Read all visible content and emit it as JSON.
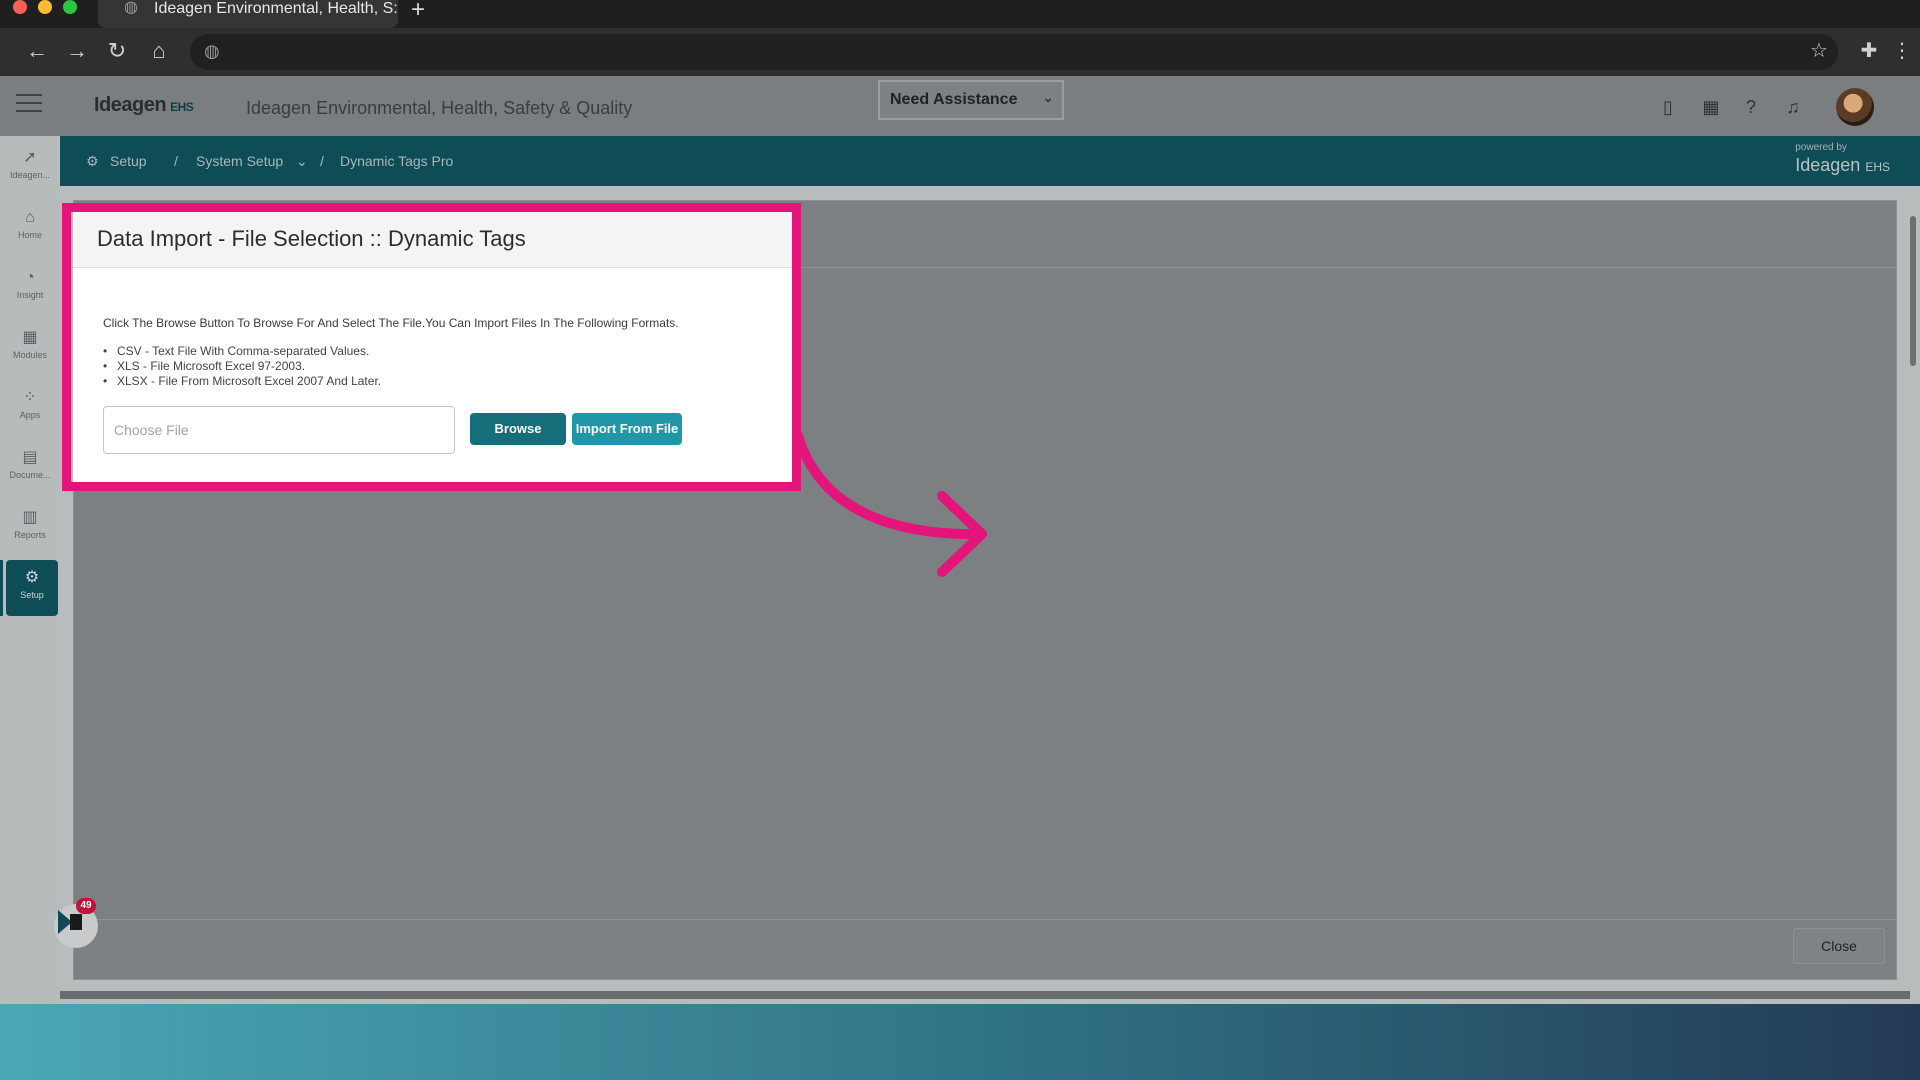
{
  "browser": {
    "tab_title": "Ideagen Environmental, Health, S:",
    "tab_icon": "globe-icon",
    "new_tab_icon": "plus-icon"
  },
  "header": {
    "logo_text": "Ideagen",
    "logo_suffix": "EHS",
    "app_title": "Ideagen Environmental, Health, Safety & Quality",
    "assistance_label": "Need Assistance"
  },
  "breadcrumb": {
    "items": [
      "Setup",
      "System Setup",
      "Dynamic Tags Pro"
    ],
    "separator": "/",
    "powered_by": "powered by",
    "powered_logo": "Ideagen",
    "powered_suffix": "EHS"
  },
  "sidebar": {
    "items": [
      {
        "label": "Ideagen...",
        "icon": "ideagen-icon"
      },
      {
        "label": "Home",
        "icon": "home-icon"
      },
      {
        "label": "Insight",
        "icon": "insight-icon"
      },
      {
        "label": "Modules",
        "icon": "modules-icon"
      },
      {
        "label": "Apps",
        "icon": "apps-icon"
      },
      {
        "label": "Docume...",
        "icon": "document-icon"
      },
      {
        "label": "Reports",
        "icon": "reports-icon"
      },
      {
        "label": "Setup",
        "icon": "gear-icon"
      }
    ]
  },
  "modal": {
    "title": "Data Import - File Selection :: Dynamic Tags",
    "instruction": "Click The Browse Button To Browse For And Select The File.You Can Import Files In The Following Formats.",
    "formats": [
      "CSV - Text File With Comma-separated Values.",
      "XLS - File Microsoft Excel 97-2003.",
      "XLSX - File From Microsoft Excel 2007 And Later."
    ],
    "file_placeholder": "Choose File",
    "browse_label": "Browse",
    "import_label": "Import From File"
  },
  "footer": {
    "close_label": "Close"
  },
  "chat": {
    "badge_count": "49"
  },
  "colors": {
    "highlight": "#e3147a",
    "teal_dark": "#0e4c56",
    "browse_button": "#156e79",
    "import_button": "#1f97a6"
  }
}
